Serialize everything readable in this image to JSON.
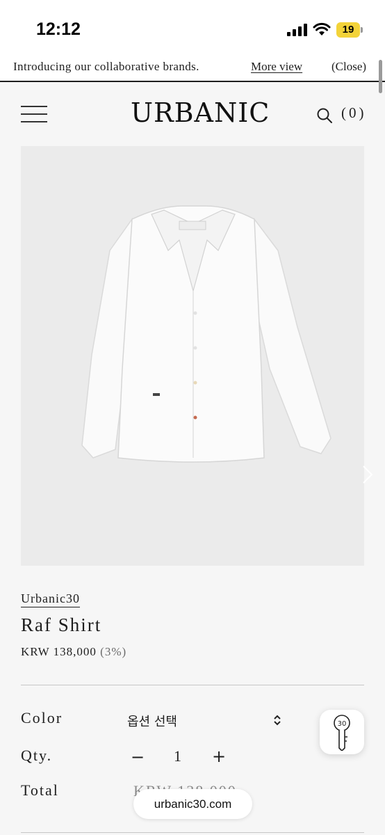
{
  "status_bar": {
    "time": "12:12",
    "battery_level": "19",
    "battery_color": "#f3d339"
  },
  "announcement": {
    "message": "Introducing our collaborative brands.",
    "more_link": "More view",
    "close_label": "(Close)"
  },
  "header": {
    "menu_icon": "hamburger-icon",
    "logo": "URBANIC",
    "search_icon": "search-icon",
    "cart_label": "(0)"
  },
  "product": {
    "image_icon": "white-shirt",
    "next_icon": "chevron-right-icon",
    "brand": "Urbanic30",
    "name": "Raf Shirt",
    "price": "KRW 138,000",
    "discount": "(3%)"
  },
  "options": {
    "color_label": "Color",
    "color_value": "옵션 선택",
    "qty_label": "Qty.",
    "qty_minus": "−",
    "qty_value": "1",
    "qty_plus": "+",
    "total_label": "Total",
    "total_value": "KRW 138,000"
  },
  "floating": {
    "key_badge": "30",
    "url": "urbanic30.com"
  }
}
